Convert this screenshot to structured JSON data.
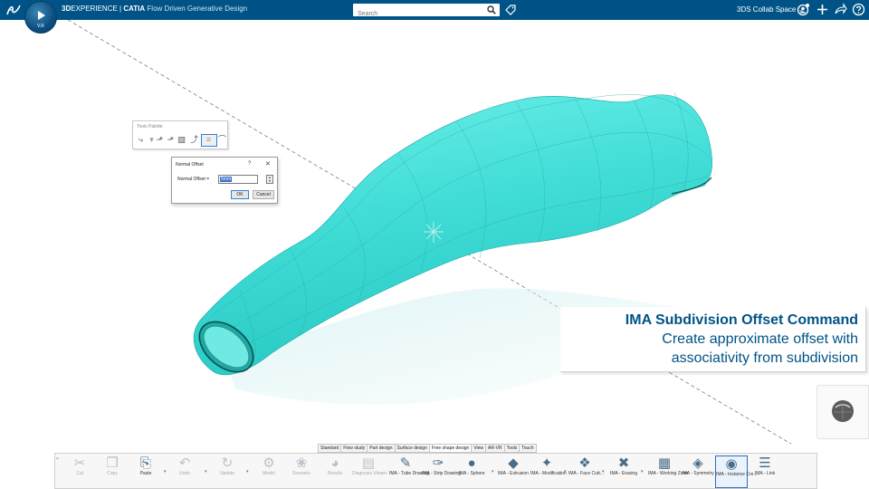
{
  "topbar": {
    "brand_bold": "3D",
    "brand_rest": "EXPERIENCE | ",
    "brand_catia": "CATIA",
    "app_name": "Flow Driven Generative Design",
    "compass_version": "V.R",
    "search_placeholder": "Search",
    "collab_space": "3DS Collab Space ⌄",
    "icons": [
      "ds-logo-icon",
      "compass-icon",
      "search-icon",
      "tag-icon",
      "user-icon",
      "add-icon",
      "share-icon",
      "help-icon"
    ]
  },
  "tools_palette": {
    "title": "Tools Palette",
    "icons": [
      "measure-icon",
      "axis-icon",
      "robot-icon",
      "surface-icon",
      "offset-icon",
      "subdivision-icon",
      "curve-icon"
    ]
  },
  "dialog": {
    "title": "Normal Offset",
    "help": "?",
    "close": "✕",
    "label": "Normal Offset =",
    "value": "5mm",
    "ok": "OK",
    "cancel": "Cancel"
  },
  "caption": {
    "line1": "IMA Subdivision Offset Command",
    "line2": "Create approximate offset with",
    "line3": "associativity from subdivision"
  },
  "tabs": [
    "Standard",
    "Flow study",
    "Part design",
    "Surface design",
    "Free shape design",
    "View",
    "AR-VR",
    "Tools",
    "Touch"
  ],
  "active_tab": "Free shape design",
  "ribbon": {
    "buttons": [
      {
        "name": "cut-button",
        "label": "Cut",
        "icon": "scissors-icon",
        "dim": true
      },
      {
        "name": "copy-button",
        "label": "Copy",
        "icon": "copy-icon",
        "dim": true
      },
      {
        "name": "paste-button",
        "label": "Paste",
        "icon": "paste-icon",
        "dim": false
      },
      {
        "name": "undo-button",
        "label": "Undo",
        "icon": "undo-icon",
        "dim": true
      },
      {
        "name": "update-button",
        "label": "Update",
        "icon": "update-icon",
        "dim": true
      },
      {
        "name": "model-button",
        "label": "Model",
        "icon": "model-icon",
        "dim": true
      },
      {
        "name": "scenario-button",
        "label": "Scenario",
        "icon": "scenario-icon",
        "dim": true
      },
      {
        "name": "results-button",
        "label": "Results",
        "icon": "results-icon",
        "dim": true
      },
      {
        "name": "diagnosis-viewer-button",
        "label": "Diagnosis Viewer",
        "icon": "diagnosis-icon",
        "dim": true
      },
      {
        "name": "ima-tube-drawing-button",
        "label": "IMA - Tube Drawing",
        "icon": "tube-drawing-icon",
        "dim": false
      },
      {
        "name": "ima-strip-drawing-button",
        "label": "IMA - Strip Drawing",
        "icon": "strip-drawing-icon",
        "dim": false
      },
      {
        "name": "ima-sphere-button",
        "label": "IMA - Sphere",
        "icon": "sphere-icon",
        "dim": false
      },
      {
        "name": "ima-extrusion-button",
        "label": "IMA - Extrusion",
        "icon": "extrusion-icon",
        "dim": false
      },
      {
        "name": "ima-modification-button",
        "label": "IMA - Modification",
        "icon": "modification-icon",
        "dim": false
      },
      {
        "name": "ima-face-cutting-button",
        "label": "IMA - Face Cutt...",
        "icon": "face-cutting-icon",
        "dim": false
      },
      {
        "name": "ima-erasing-button",
        "label": "IMA - Erasing",
        "icon": "erasing-icon",
        "dim": false
      },
      {
        "name": "ima-working-zone-button",
        "label": "IMA - Working Zone",
        "icon": "working-zone-icon",
        "dim": false
      },
      {
        "name": "ima-symmetry-button",
        "label": "IMA - Symmetry",
        "icon": "symmetry-icon",
        "dim": false
      },
      {
        "name": "ima-instance-creation-button",
        "label": "IMA - Instance Cre...",
        "icon": "instance-icon",
        "dim": false
      },
      {
        "name": "ima-link-button",
        "label": "IMA - Link",
        "icon": "link-icon",
        "dim": false
      }
    ]
  },
  "colors": {
    "topbar": "#005386",
    "shape": "#4fe3dd",
    "caption_text": "#005386",
    "selection": "#2d6fbf"
  }
}
